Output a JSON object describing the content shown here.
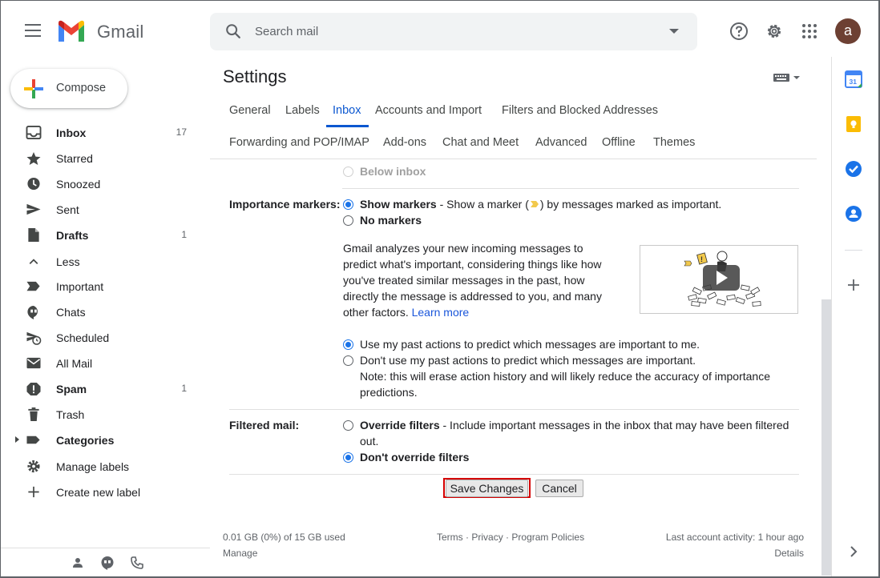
{
  "app": {
    "name": "Gmail",
    "account_initial": "a"
  },
  "search": {
    "placeholder": "Search mail"
  },
  "compose": {
    "label": "Compose"
  },
  "nav": {
    "items": [
      {
        "label": "Inbox",
        "count": "17",
        "bold": true,
        "icon": "inbox-icon"
      },
      {
        "label": "Starred",
        "count": "",
        "bold": false,
        "icon": "star-icon"
      },
      {
        "label": "Snoozed",
        "count": "",
        "bold": false,
        "icon": "clock-icon"
      },
      {
        "label": "Sent",
        "count": "",
        "bold": false,
        "icon": "send-icon"
      },
      {
        "label": "Drafts",
        "count": "1",
        "bold": true,
        "icon": "draft-icon"
      },
      {
        "label": "Less",
        "count": "",
        "bold": false,
        "icon": "chevron-up-icon"
      },
      {
        "label": "Important",
        "count": "",
        "bold": false,
        "icon": "important-icon"
      },
      {
        "label": "Chats",
        "count": "",
        "bold": false,
        "icon": "chat-icon"
      },
      {
        "label": "Scheduled",
        "count": "",
        "bold": false,
        "icon": "scheduled-icon"
      },
      {
        "label": "All Mail",
        "count": "",
        "bold": false,
        "icon": "mail-icon"
      },
      {
        "label": "Spam",
        "count": "1",
        "bold": true,
        "icon": "spam-icon"
      },
      {
        "label": "Trash",
        "count": "",
        "bold": false,
        "icon": "trash-icon"
      },
      {
        "label": "Categories",
        "count": "",
        "bold": true,
        "icon": "label-icon"
      },
      {
        "label": "Manage labels",
        "count": "",
        "bold": false,
        "icon": "gear-icon"
      },
      {
        "label": "Create new label",
        "count": "",
        "bold": false,
        "icon": "plus-icon"
      }
    ]
  },
  "settings": {
    "title": "Settings",
    "tabs_row1": [
      "General",
      "Labels",
      "Inbox",
      "Accounts and Import",
      "Filters and Blocked Addresses"
    ],
    "tabs_row2": [
      "Forwarding and POP/IMAP",
      "Add-ons",
      "Chat and Meet",
      "Advanced",
      "Offline",
      "Themes"
    ],
    "active_tab": "Inbox",
    "below_inbox": "Below inbox",
    "importance": {
      "label": "Importance markers:",
      "show_markers": "Show markers",
      "show_markers_desc_1": " - Show a marker (",
      "show_markers_desc_2": ") by messages marked as important.",
      "no_markers": "No markers",
      "explain_lines": [
        "Gmail analyzes your new incoming messages to",
        "predict what's important, considering things like how",
        "you've treated similar messages in the past, how",
        "directly the message is addressed to you, and many"
      ],
      "explain_last": "other factors. ",
      "learn_more": "Learn more",
      "use_past": "Use my past actions to predict which messages are important to me.",
      "dont_use_past": "Don't use my past actions to predict which messages are important.",
      "note_1": "Note: this will erase action history and will likely reduce the accuracy of importance",
      "note_2": "predictions."
    },
    "filtered": {
      "label": "Filtered mail:",
      "override": "Override filters",
      "override_desc": " - Include important messages in the inbox that may have been filtered",
      "override_desc_2": "out.",
      "dont_override": "Don't override filters"
    },
    "buttons": {
      "save": "Save Changes",
      "cancel": "Cancel"
    }
  },
  "footer": {
    "storage": "0.01 GB (0%) of 15 GB used",
    "manage": "Manage",
    "terms": "Terms",
    "sep": "·",
    "privacy": "Privacy",
    "policies": "Program Policies",
    "activity": "Last account activity: 1 hour ago",
    "details": "Details"
  },
  "colors": {
    "accent": "#0b57d0",
    "radio": "#1a73e8",
    "highlight": "#d50000"
  }
}
